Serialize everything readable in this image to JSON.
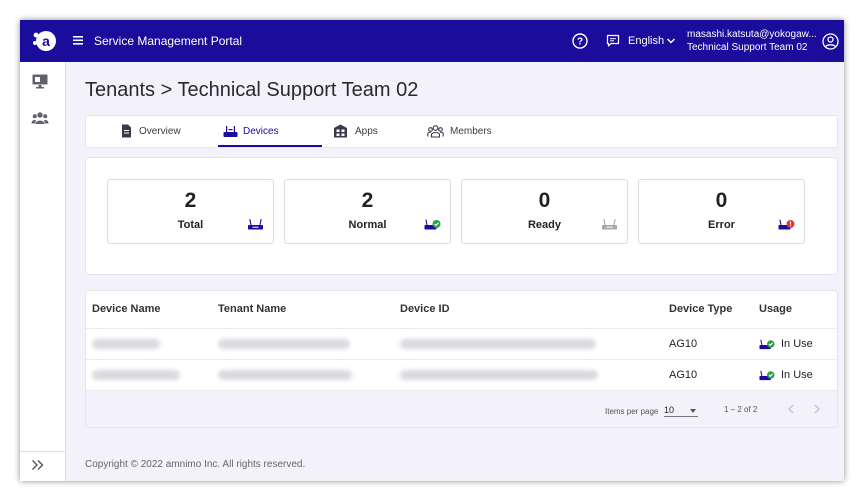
{
  "header": {
    "title": "Service Management Portal",
    "language": "English",
    "user_email": "masashi.katsuta@yokogaw...",
    "user_tenant": "Technical Support Team 02"
  },
  "breadcrumb": "Tenants > Technical Support Team 02",
  "tabs": [
    {
      "label": "Overview"
    },
    {
      "label": "Devices"
    },
    {
      "label": "Apps"
    },
    {
      "label": "Members"
    }
  ],
  "summary": [
    {
      "count": "2",
      "label": "Total"
    },
    {
      "count": "2",
      "label": "Normal"
    },
    {
      "count": "0",
      "label": "Ready"
    },
    {
      "count": "0",
      "label": "Error"
    }
  ],
  "table": {
    "columns": [
      "Device Name",
      "Tenant Name",
      "Device ID",
      "Device Type",
      "Usage"
    ],
    "rows": [
      {
        "device_type": "AG10",
        "usage": "In Use"
      },
      {
        "device_type": "AG10",
        "usage": "In Use"
      }
    ]
  },
  "pagination": {
    "items_per_page_label": "Items per page",
    "items_per_page": "10",
    "range": "1 – 2 of 2"
  },
  "footer": "Copyright © 2022 amnimo Inc. All rights reserved.",
  "colors": {
    "brand": "#1a0d9b",
    "background": "#f3f2fb",
    "status_normal": "#2ea043",
    "status_error": "#e53935"
  }
}
